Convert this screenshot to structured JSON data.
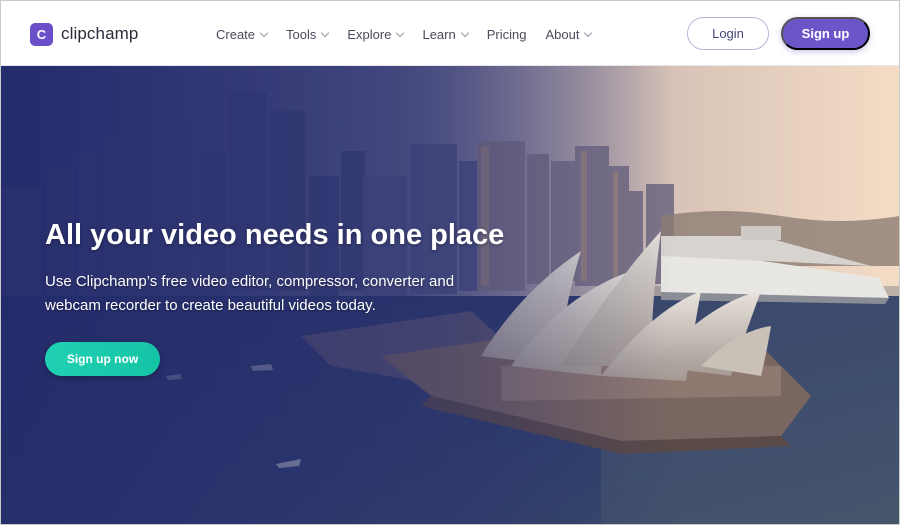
{
  "header": {
    "logo_letter": "C",
    "logo_text": "clipchamp",
    "nav": [
      {
        "label": "Create",
        "dropdown": true
      },
      {
        "label": "Tools",
        "dropdown": true
      },
      {
        "label": "Explore",
        "dropdown": true
      },
      {
        "label": "Learn",
        "dropdown": true
      },
      {
        "label": "Pricing",
        "dropdown": false
      },
      {
        "label": "About",
        "dropdown": true
      }
    ],
    "login_label": "Login",
    "signup_label": "Sign up"
  },
  "hero": {
    "title": "All your video needs in one place",
    "subtitle": "Use Clipchamp’s free video editor, compressor, converter and webcam recorder to create beautiful videos today.",
    "cta_label": "Sign up now"
  },
  "colors": {
    "brand": "#6a4fc8",
    "signup_button": "#6c55c9",
    "cta": "#1fd1b2",
    "overlay": "#2a2f6e"
  }
}
